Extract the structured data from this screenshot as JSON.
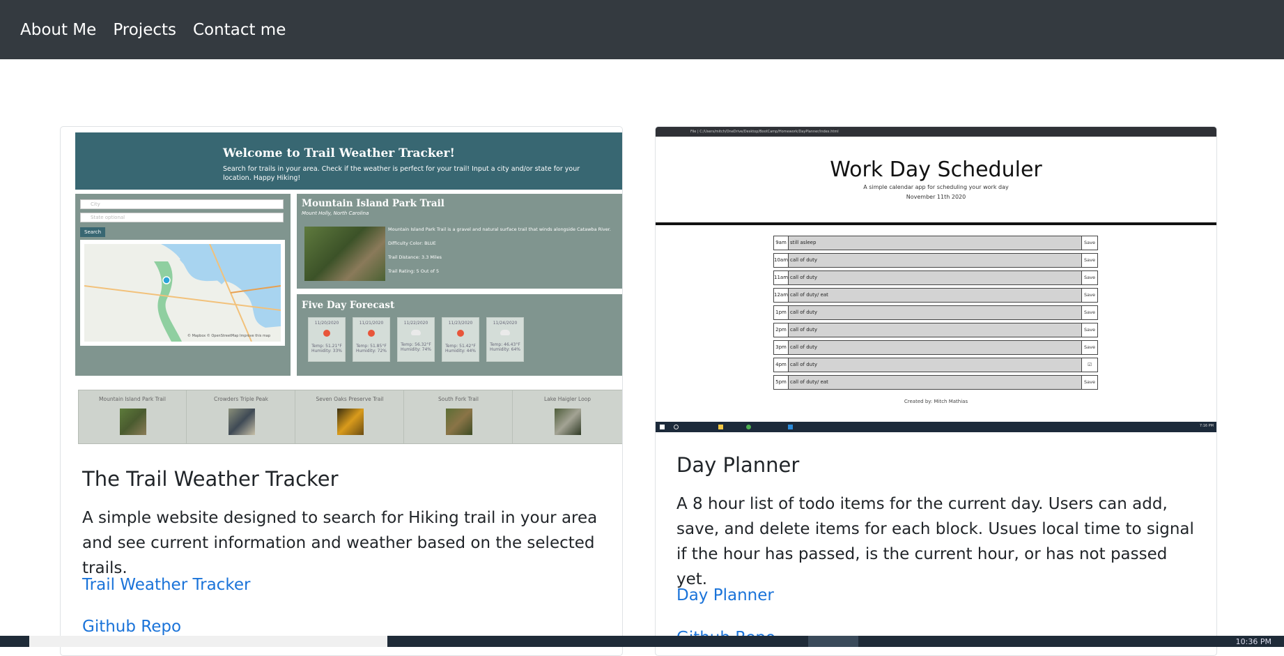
{
  "nav": {
    "about": "About Me",
    "projects": "Projects",
    "contact": "Contact me"
  },
  "trail_card": {
    "title": "The Trail Weather Tracker",
    "text": "A simple website designed to search for Hiking trail in your area and see current information and weather based on the selected trails.",
    "link_site": "Trail Weather Tracker",
    "link_repo": "Github Repo",
    "screenshot": {
      "header_title": "Welcome to Trail Weather Tracker!",
      "header_sub": "Search for trails in your area. Check if the weather is perfect for your trail! Input a city and/or state for your location. Happy Hiking!",
      "city_placeholder": "City",
      "state_placeholder": "State optional",
      "search_label": "Search",
      "trail_name": "Mountain Island Park Trail",
      "trail_location": "Mount Holly, North Carolina",
      "trail_desc": "Mountain Island Park Trail is a gravel and natural surface trail that winds alongside Catawba River.",
      "difficulty": "Difficulty Color: BLUE",
      "distance": "Trail Distance: 3.3 Miles",
      "rating": "Trail Rating: 5 Out of 5",
      "forecast_title": "Five Day Forecast",
      "forecast": [
        {
          "date": "11/20/2020",
          "temp": "Temp: 51.21°F",
          "hum": "Humidity: 33%"
        },
        {
          "date": "11/21/2020",
          "temp": "Temp: 51.85°F",
          "hum": "Humidity: 72%"
        },
        {
          "date": "11/22/2020",
          "temp": "Temp: 56.32°F",
          "hum": "Humidity: 74%"
        },
        {
          "date": "11/23/2020",
          "temp": "Temp: 51.42°F",
          "hum": "Humidity: 44%"
        },
        {
          "date": "11/24/2020",
          "temp": "Temp: 46.43°F",
          "hum": "Humidity: 64%"
        }
      ],
      "map_credit": "© Mapbox © OpenStreetMap Improve this map",
      "trails": [
        "Mountain Island Park Trail",
        "Crowders Triple Peak",
        "Seven Oaks Preserve Trail",
        "South Fork Trail",
        "Lake Haigler Loop"
      ]
    }
  },
  "planner_card": {
    "title": "Day Planner",
    "text": "A 8 hour list of todo items for the current day. Users can add, save, and delete items for each block. Usues local time to signal if the hour has passed, is the current hour, or has not passed yet.",
    "link_site": "Day Planner",
    "link_repo": "Github Repo",
    "screenshot": {
      "address": "File | C:/Users/mitch/OneDrive/Desktop/BootCamp/Homework/DayPlanner/index.html",
      "title": "Work Day Scheduler",
      "sub": "A simple calendar app for scheduling your work day",
      "date": "November 11th 2020",
      "rows": [
        {
          "hour": "9am",
          "text": "still asleep",
          "btn": "Save"
        },
        {
          "hour": "10am",
          "text": "call of duty",
          "btn": "Save"
        },
        {
          "hour": "11am",
          "text": "call of duty",
          "btn": "Save"
        },
        {
          "hour": "12am",
          "text": "call of duty/ eat",
          "btn": "Save"
        },
        {
          "hour": "1pm",
          "text": "call of duty",
          "btn": "Save"
        },
        {
          "hour": "2pm",
          "text": "call of duty",
          "btn": "Save"
        },
        {
          "hour": "3pm",
          "text": "call of duty",
          "btn": "Save"
        },
        {
          "hour": "4pm",
          "text": "call of duty",
          "btn": "☑"
        },
        {
          "hour": "5pm",
          "text": "call of duty/ eat",
          "btn": "Save"
        }
      ],
      "credit": "Created by: Mitch Mathias",
      "clock": "7:16 PM"
    }
  },
  "taskbar": {
    "time": "10:36 PM"
  }
}
